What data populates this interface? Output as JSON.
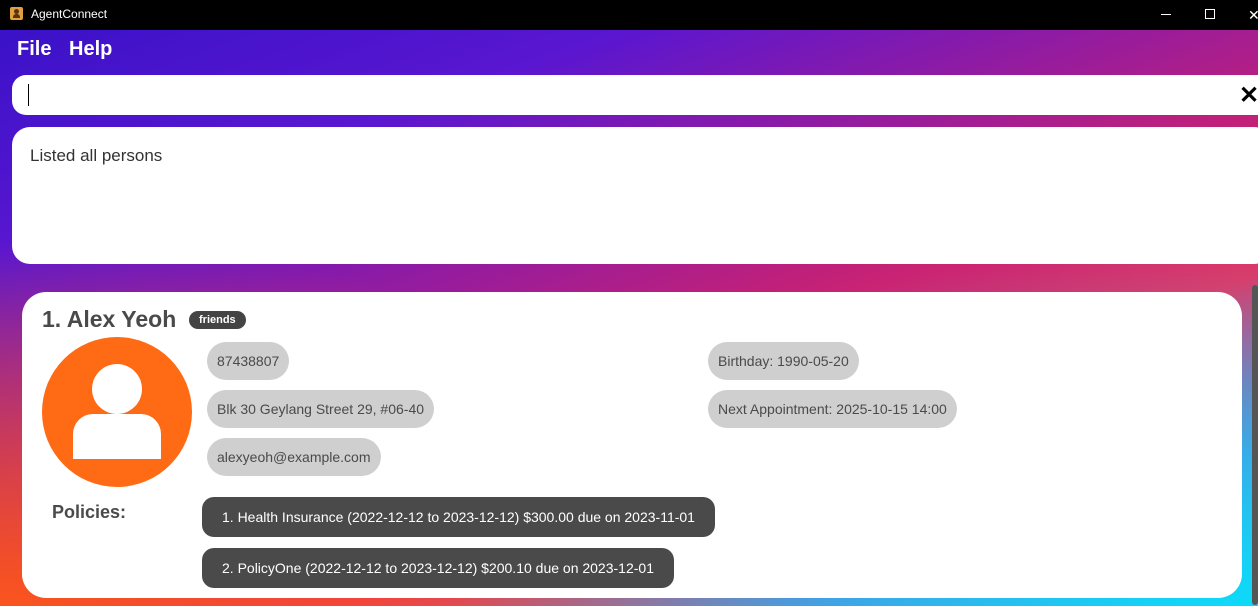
{
  "window": {
    "title": "AgentConnect",
    "icon": "person-icon",
    "controls": [
      "minimize-icon",
      "maximize-icon",
      "close-icon"
    ],
    "close_glyph": "✕"
  },
  "menu": {
    "items": [
      "File",
      "Help"
    ]
  },
  "command": {
    "value": "",
    "clear_icon": "✕"
  },
  "result": {
    "text": "Listed all persons"
  },
  "person": {
    "name": "1. Alex Yeoh",
    "tag": "friends",
    "phone": "87438807",
    "address": "Blk 30 Geylang Street 29, #06-40",
    "email": "alexyeoh@example.com",
    "birthday": "Birthday: 1990-05-20",
    "next_appointment": "Next Appointment: 2025-10-15 14:00",
    "policies_label": "Policies:",
    "policies": [
      "1. Health Insurance (2022-12-12 to 2023-12-12) $300.00 due on 2023-11-01",
      "2. PolicyOne (2022-12-12 to 2023-12-12) $200.10 due on 2023-12-01"
    ]
  },
  "colors": {
    "avatar": "#ff6a14",
    "tag_bg": "#444444",
    "pill_bg": "#cfcfcf",
    "policy_bg": "#4a4a4a"
  }
}
